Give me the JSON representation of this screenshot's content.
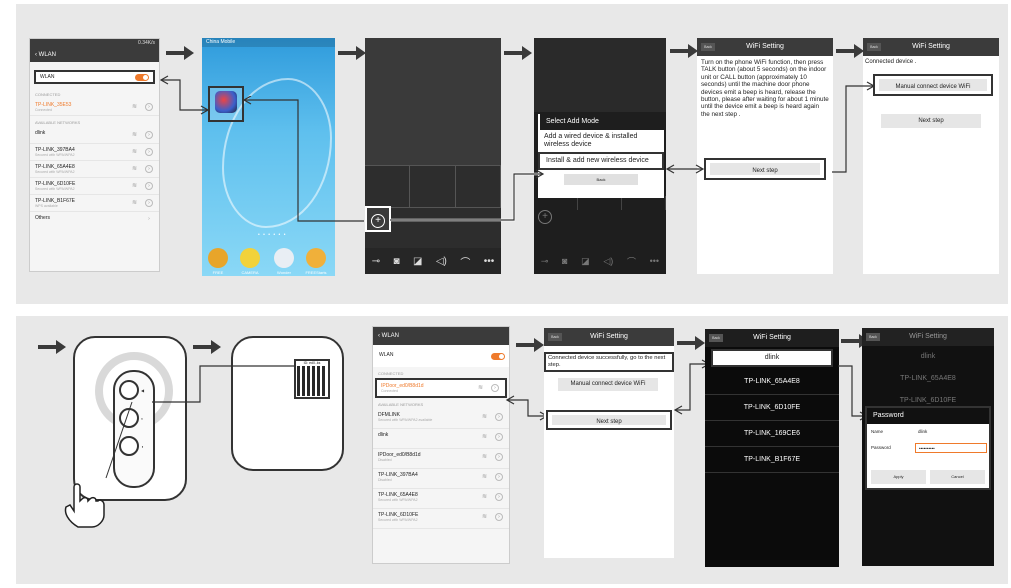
{
  "row1": {
    "wlan_list": {
      "status": "0.34K/s",
      "title": "WLAN",
      "wlan_label": "WLAN",
      "connected_header": "CONNECTED",
      "connected": {
        "name": "TP-LINK_35E53",
        "sub": "Connected"
      },
      "available_header": "AVAILABLE NETWORKS",
      "networks": [
        {
          "name": "dlink",
          "sub": ""
        },
        {
          "name": "TP-LINK_397BA4",
          "sub": "Secured with WPA/WPA2"
        },
        {
          "name": "TP-LINK_65A4E8",
          "sub": "Secured with WPA/WPA2"
        },
        {
          "name": "TP-LINK_6D10FE",
          "sub": "Secured with WPA/WPA2"
        },
        {
          "name": "TP-LINK_B1F67E",
          "sub": "WPS available"
        }
      ],
      "others": "Others"
    },
    "home": {
      "carrier": "China Mobile",
      "dock": [
        "FREE",
        "CAMERA",
        "Wonder",
        "FREEStarts"
      ]
    },
    "monitor": {
      "toolbar_icons": [
        "unlock-icon",
        "camera-icon",
        "video-icon",
        "speaker-icon",
        "phone-icon",
        "more-icon"
      ]
    },
    "add_mode": {
      "title": "Select Add Mode",
      "option_wired": "Add a wired device & installed wireless device",
      "option_wireless": "Install & add new wireless device",
      "back": "Back"
    },
    "wifi_setting": {
      "back": "Back",
      "title": "WiFi Setting",
      "instructions": "Turn on the phone WiFi function, then press TALK button (about 5 seconds) on the indoor unit or CALL button (approximately 10 seconds) until the machine door phone devices emit a beep is heard, release the button, please after waiting for about 1 minute until the device emit a beep is heard again the next step .",
      "next": "Next step"
    },
    "wifi_setting2": {
      "back": "Back",
      "title": "WiFi Setting",
      "connected": "Connected device .",
      "manual": "Manual connect device WiFi",
      "next": "Next step"
    }
  },
  "row2": {
    "qr_label": "ID: ed0..ks",
    "wlan": {
      "title": "WLAN",
      "wlan_label": "WLAN",
      "connected_header": "CONNECTED",
      "connected": {
        "name": "IPDoor_ed0/B8d1d",
        "sub": "Connected"
      },
      "available_header": "AVAILABLE NETWORKS",
      "networks": [
        {
          "name": "DFMLINK",
          "sub": "Secured with WPA/WPA2 available"
        },
        {
          "name": "dlink",
          "sub": ""
        },
        {
          "name": "IPDoor_ed0/B8d1d",
          "sub": "Disabled"
        },
        {
          "name": "TP-LINK_397BA4",
          "sub": "Disabled"
        },
        {
          "name": "TP-LINK_65A4E8",
          "sub": "Secured with WPA/WPA2"
        },
        {
          "name": "TP-LINK_6D10FE",
          "sub": "Secured with WPA/WPA2"
        }
      ]
    },
    "wifi_setting": {
      "back": "Back",
      "title": "WiFi Setting",
      "connected": "Connected device successfully, go to the next step.",
      "manual": "Manual connect device WiFi",
      "next": "Next step"
    },
    "wifi_list": {
      "back": "Back",
      "title": "WiFi Setting",
      "items": [
        "dlink",
        "TP-LINK_65A4E8",
        "TP-LINK_6D10FE",
        "TP-LINK_169CE6",
        "TP-LINK_B1F67E"
      ]
    },
    "password": {
      "back": "Back",
      "title": "WiFi Setting",
      "bg_items": [
        "dlink",
        "TP-LINK_65A4E8",
        "TP-LINK_6D10FE"
      ],
      "dialog_title": "Password",
      "name_label": "Name",
      "name_value": "dlink",
      "password_label": "Password",
      "password_value": "••••••••••",
      "apply": "Apply",
      "cancel": "Cancel"
    }
  },
  "colors": {
    "accent": "#ef7a2b",
    "band": "#e8e8e8",
    "dark": "#3b3b3b"
  }
}
